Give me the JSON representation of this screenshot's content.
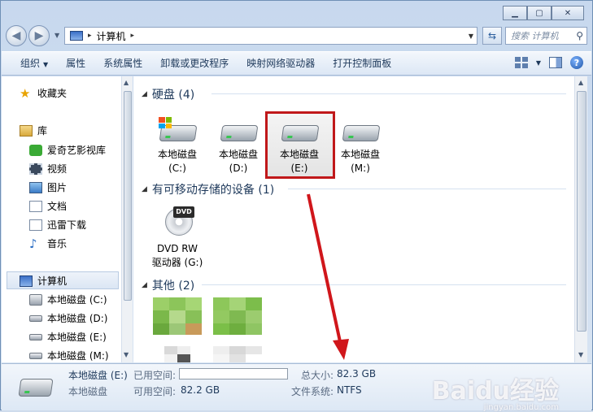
{
  "window": {
    "caption_minimize": "▁",
    "caption_maximize": "▢",
    "caption_close": "✕"
  },
  "address": {
    "path_root_sep": "▸",
    "location": "计算机",
    "trail_sep": "▸"
  },
  "search": {
    "placeholder": "搜索 计算机"
  },
  "toolbar": {
    "organize": "组织",
    "properties": "属性",
    "system_properties": "系统属性",
    "uninstall": "卸载或更改程序",
    "map_drive": "映射网络驱动器",
    "control_panel": "打开控制面板",
    "help": "?"
  },
  "sidebar": {
    "favorites": "收藏夹",
    "libraries": "库",
    "lib_items": [
      "爱奇艺影视库",
      "视频",
      "图片",
      "文档",
      "迅雷下载",
      "音乐"
    ],
    "computer": "计算机",
    "drives": [
      "本地磁盘 (C:)",
      "本地磁盘 (D:)",
      "本地磁盘 (E:)",
      "本地磁盘 (M:)"
    ]
  },
  "groups": {
    "hard_disks": "硬盘 (4)",
    "removable": "有可移动存储的设备 (1)",
    "other": "其他 (2)"
  },
  "drives": [
    {
      "name": "本地磁盘",
      "letter": "(C:)"
    },
    {
      "name": "本地磁盘",
      "letter": "(D:)"
    },
    {
      "name": "本地磁盘",
      "letter": "(E:)"
    },
    {
      "name": "本地磁盘",
      "letter": "(M:)"
    }
  ],
  "dvd": {
    "badge": "DVD",
    "name": "DVD RW",
    "label": "驱动器 (G:)"
  },
  "details": {
    "title": "本地磁盘 (E:)",
    "type": "本地磁盘",
    "used_label": "已用空间:",
    "free_label": "可用空间:",
    "free_value": "82.2 GB",
    "total_label": "总大小:",
    "total_value": "82.3 GB",
    "fs_label": "文件系统:",
    "fs_value": "NTFS",
    "used_fraction": 0.0
  },
  "watermark": {
    "brand": "Baidu经验",
    "url": "jingyan.baidu.com"
  },
  "colors": {
    "highlight_box": "#c0181a",
    "annotation_arrow": "#d0161b"
  }
}
